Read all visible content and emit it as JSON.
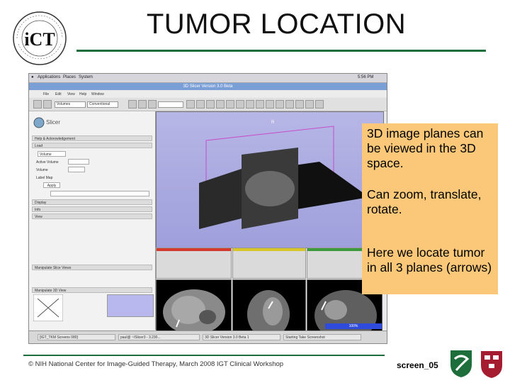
{
  "slide": {
    "title": "TUMOR LOCATION",
    "footer": "© NIH National Center for Image-Guided Therapy, March 2008 IGT Clinical Workshop",
    "screen_label": "screen_05",
    "accent_color": "#1d6e3a",
    "callout_color": "#fbc87a",
    "callout": [
      "3D image planes can be viewed in the 3D space.",
      "Can zoom, translate, rotate.",
      "Here we locate tumor in all 3 planes (arrows)"
    ]
  },
  "desktop": {
    "menu": [
      "Applications",
      "Places",
      "System"
    ],
    "clock": "5:56 PM",
    "window_title": "3D Slicer Version 3.0 Beta",
    "app_menu": [
      "File",
      "Edit",
      "View",
      "Help",
      "Window"
    ],
    "toolbar_fields": [
      "Volumes",
      "Conventional"
    ],
    "left_panel": {
      "app_name": "Slicer",
      "sections": [
        "Help & Acknowledgement",
        "Load",
        "Display",
        "Info",
        "View"
      ],
      "active_volume": "Volume",
      "fields": [
        "Active Volume",
        "Volume",
        "Label Map",
        "Apply"
      ],
      "lower_sections": [
        "Manipulate Slice Views",
        "Manipulate 3D View"
      ]
    },
    "slice_views": [
      {
        "name": "Red",
        "color": "#d33a2c"
      },
      {
        "name": "Yellow",
        "color": "#d8c52a"
      },
      {
        "name": "Green",
        "color": "#3c9a3c"
      }
    ],
    "view_labels": [
      "R"
    ],
    "progress": "100%",
    "taskbar": [
      "[IGT_TKM Screens 080]",
      "paul@ ~/Slicer3 - 3.230...",
      "3D Slicer Version 3.0 Beta 1",
      "Starting Take Screenshot"
    ]
  }
}
